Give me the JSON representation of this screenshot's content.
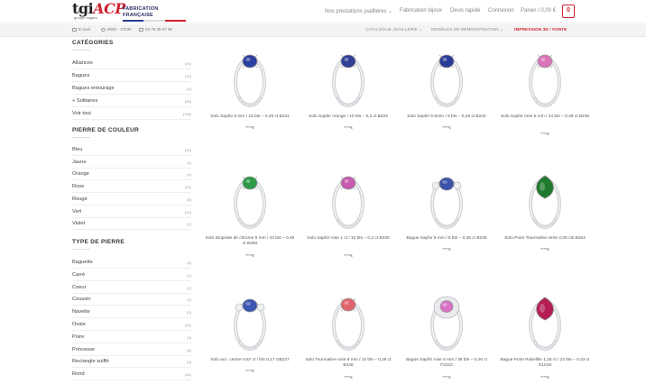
{
  "header": {
    "logo_main_1": "tgi",
    "logo_main_2": "ACP",
    "logo_sub": "groupe bogaro",
    "fabrication": "FABRICATION FRANÇAISE",
    "nav": [
      "Nos prestations joaillières ⌄",
      "Fabrication bijoux",
      "Devis rapide",
      "Connexion",
      "Panier / 0,00 €"
    ],
    "cart_count": "0"
  },
  "subbar": {
    "email": "E-mail",
    "hours": "8h00 - 17h30",
    "phone": "04 75 35 07 96",
    "menus": [
      "CATALOGUE JOAILLERIE ⌄",
      "MODÈLES DE DÉMONSTRATION ⌄",
      "IMPRESSION 3D / FONTE"
    ]
  },
  "sidebar": {
    "categories_title": "CATÉGORIES",
    "categories": [
      {
        "label": "Alliances",
        "count": "(91)"
      },
      {
        "label": "Bagues",
        "count": "(75)"
      },
      {
        "label": "Bagues entourage",
        "count": "(4)"
      },
      {
        "label": "+  Solitaires",
        "count": "(36)"
      },
      {
        "label": "Voir tout",
        "count": "(198)"
      }
    ],
    "color_title": "PIERRE DE COULEUR",
    "colors": [
      {
        "label": "Bleu",
        "count": "(30)"
      },
      {
        "label": "Jaune",
        "count": "(3)"
      },
      {
        "label": "Orange",
        "count": "(4)"
      },
      {
        "label": "Rose",
        "count": "(23)"
      },
      {
        "label": "Rouge",
        "count": "(6)"
      },
      {
        "label": "Vert",
        "count": "(10)"
      },
      {
        "label": "Violet",
        "count": "(2)"
      }
    ],
    "type_title": "TYPE DE PIERRE",
    "types": [
      {
        "label": "Baguette",
        "count": "(3)"
      },
      {
        "label": "Carré",
        "count": "(2)"
      },
      {
        "label": "Coeur",
        "count": "(2)"
      },
      {
        "label": "Coussin",
        "count": "(3)"
      },
      {
        "label": "Navette",
        "count": "(3)"
      },
      {
        "label": "Ovale",
        "count": "(24)"
      },
      {
        "label": "Poire",
        "count": "(9)"
      },
      {
        "label": "Princesse",
        "count": "(6)"
      },
      {
        "label": "Rectangle suiffé",
        "count": "(3)"
      },
      {
        "label": "Rond",
        "count": "(14)"
      }
    ]
  },
  "products": [
    {
      "name": "Solo Saphir 5 mm / 16 bts – 0,28 ct B224",
      "price": "****€",
      "gem": "#2b3f9e",
      "style": "solitaire"
    },
    {
      "name": "Solo Saphir orange / 10 bts – 0,2 ct B229",
      "price": "****€",
      "gem": "#2f3f95",
      "style": "solitaire"
    },
    {
      "name": "Solo Saphir 5.5mm / 8 bts – 0,26 ct B242",
      "price": "****€",
      "gem": "#2a3c96",
      "style": "solitaire"
    },
    {
      "name": "Solo Saphir rose 5 mm / 24 bts – 0,29 ct B245",
      "price": "****€",
      "gem": "#d874b8",
      "style": "solitaire"
    },
    {
      "name": "Solo Diopside de chrome 5 mm / 44 bts – 0,46 ct B266",
      "price": "****€",
      "gem": "#2e9a48",
      "style": "solitaire"
    },
    {
      "name": "Solo Saphir rose 1 ct / 10 bts – 0,2 ct B230",
      "price": "****€",
      "gem": "#c55ab0",
      "style": "solitaire"
    },
    {
      "name": "Bague Saphir 5 mm / 6 bts – 0,45 ct B226",
      "price": "****€",
      "gem": "#3a52a8",
      "style": "trio"
    },
    {
      "name": "Solo Poire Tourmaline verte 2,06 cts B254",
      "price": "****€",
      "gem": "#1f7a2e",
      "style": "pear"
    },
    {
      "name": "Solo acc. centre 0,67 ct / bts 0,17 ctB227",
      "price": "****€",
      "gem": "#3b55b0",
      "style": "trio"
    },
    {
      "name": "Solo Tourmaline rose 8 mm / 10 bts – 0,26 ct B246",
      "price": "****€",
      "gem": "#e0646e",
      "style": "solitaire"
    },
    {
      "name": "Bague Saphir rose 6 mm / 36 bts – 0,46 ct F2310",
      "price": "****€",
      "gem": "#d873c6",
      "style": "pave"
    },
    {
      "name": "Bague Poire Rubellite 1,25 ct / 22 bts – 0,43 ct D1019",
      "price": "****€",
      "gem": "#b51e55",
      "style": "pear"
    }
  ]
}
